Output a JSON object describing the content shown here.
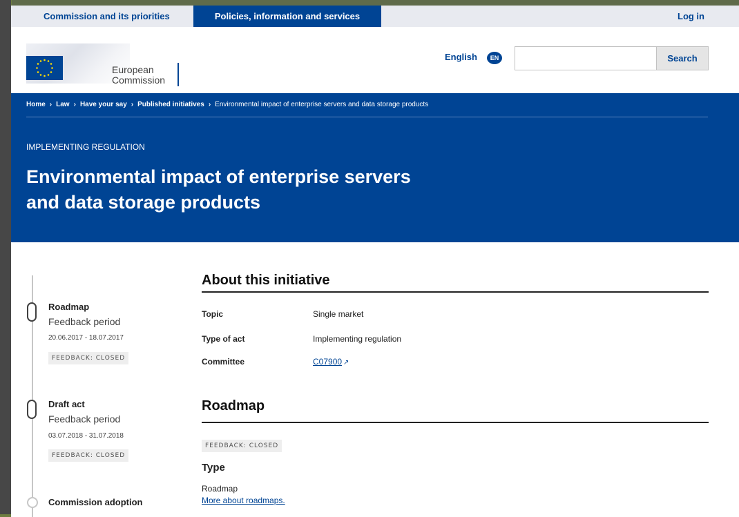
{
  "topnav": {
    "commission": "Commission and its priorities",
    "policies": "Policies, information and services",
    "login": "Log in"
  },
  "header": {
    "org_line1": "European",
    "org_line2": "Commission",
    "language": "English",
    "language_code": "EN",
    "search_placeholder": "",
    "search_button": "Search"
  },
  "breadcrumb": {
    "items": [
      "Home",
      "Law",
      "Have your say",
      "Published initiatives"
    ],
    "current": "Environmental impact of enterprise servers and data storage products"
  },
  "banner": {
    "doc_type": "IMPLEMENTING REGULATION",
    "title_line1": "Environmental impact of enterprise servers",
    "title_line2": "and data storage products"
  },
  "timeline": {
    "steps": [
      {
        "title": "Roadmap",
        "subtitle": "Feedback period",
        "dates": "20.06.2017 - 18.07.2017",
        "status": "FEEDBACK: CLOSED"
      },
      {
        "title": "Draft act",
        "subtitle": "Feedback period",
        "dates": "03.07.2018 - 31.07.2018",
        "status": "FEEDBACK: CLOSED"
      },
      {
        "title": "Commission adoption"
      }
    ]
  },
  "about": {
    "heading": "About this initiative",
    "rows": [
      {
        "key": "Topic",
        "value": "Single market"
      },
      {
        "key": "Type of act",
        "value": "Implementing regulation"
      },
      {
        "key": "Committee",
        "value": "C07900"
      }
    ]
  },
  "roadmap": {
    "heading": "Roadmap",
    "status": "FEEDBACK: CLOSED",
    "type_heading": "Type",
    "type_value": "Roadmap",
    "more_link": "More about roadmaps."
  },
  "colors": {
    "brand_blue": "#004494",
    "nav_bg": "#e8eaf0"
  }
}
